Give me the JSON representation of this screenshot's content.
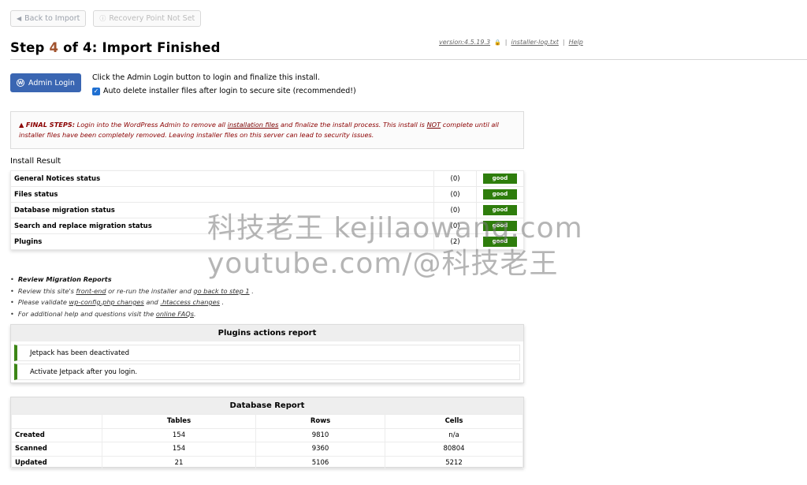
{
  "toolbar": {
    "back_label": "Back to Import",
    "recovery_label": "Recovery Point Not Set"
  },
  "header": {
    "title_prefix": "Step ",
    "step_current": "4",
    "title_suffix": " of 4: Import Finished",
    "version": "version:4.5.19.3",
    "log_link": "installer-log.txt",
    "help_link": "Help"
  },
  "login": {
    "button_label": "Admin Login",
    "instruction": "Click the Admin Login button to login and finalize this install.",
    "autodelete_label": "Auto delete installer files after login to secure site (recommended!)",
    "autodelete_checked": true
  },
  "final_steps": {
    "lead": "FINAL STEPS:",
    "text1": " Login into the WordPress Admin to remove all ",
    "link1": "installation files",
    "text2": " and finalize the install process. This install is ",
    "not_word": "NOT",
    "text3": " complete until all installer files have been completely removed. Leaving installer files on this server can lead to security issues."
  },
  "install_result": {
    "label": "Install Result",
    "rows": [
      {
        "name": "General Notices status",
        "count": "(0)",
        "status": "good"
      },
      {
        "name": "Files status",
        "count": "(0)",
        "status": "good"
      },
      {
        "name": "Database migration status",
        "count": "(0)",
        "status": "good"
      },
      {
        "name": "Search and replace migration status",
        "count": "(0)",
        "status": "good"
      },
      {
        "name": "Plugins",
        "count": "(2)",
        "status": "good"
      }
    ]
  },
  "notes": {
    "review_heading": "Review Migration Reports",
    "line2_a": "Review this site's ",
    "line2_link1": "front-end",
    "line2_b": " or re-run the installer and ",
    "line2_link2": "go back to step 1",
    "line2_c": " .",
    "line3_a": "Please validate ",
    "line3_link1": "wp-config.php changes",
    "line3_b": " and ",
    "line3_link2": ".htaccess changes",
    "line3_c": " .",
    "line4_a": "For additional help and questions visit the ",
    "line4_link": "online FAQs",
    "line4_c": "."
  },
  "plugins_report": {
    "title": "Plugins actions report",
    "items": [
      "Jetpack has been deactivated",
      "Activate Jetpack after you login."
    ]
  },
  "database_report": {
    "title": "Database Report",
    "columns": [
      "",
      "Tables",
      "Rows",
      "Cells"
    ],
    "rows": [
      {
        "label": "Created",
        "tables": "154",
        "rows": "9810",
        "cells": "n/a"
      },
      {
        "label": "Scanned",
        "tables": "154",
        "rows": "9360",
        "cells": "80804"
      },
      {
        "label": "Updated",
        "tables": "21",
        "rows": "5106",
        "cells": "5212"
      }
    ]
  },
  "watermark": {
    "line1": "科技老王 kejilaowang.com",
    "line2": "youtube.com/@科技老王"
  },
  "colors": {
    "accent_blue": "#3a66b2",
    "good_green": "#2e7d0c",
    "warning_red": "#8b0000",
    "step_number": "#a0522d"
  }
}
